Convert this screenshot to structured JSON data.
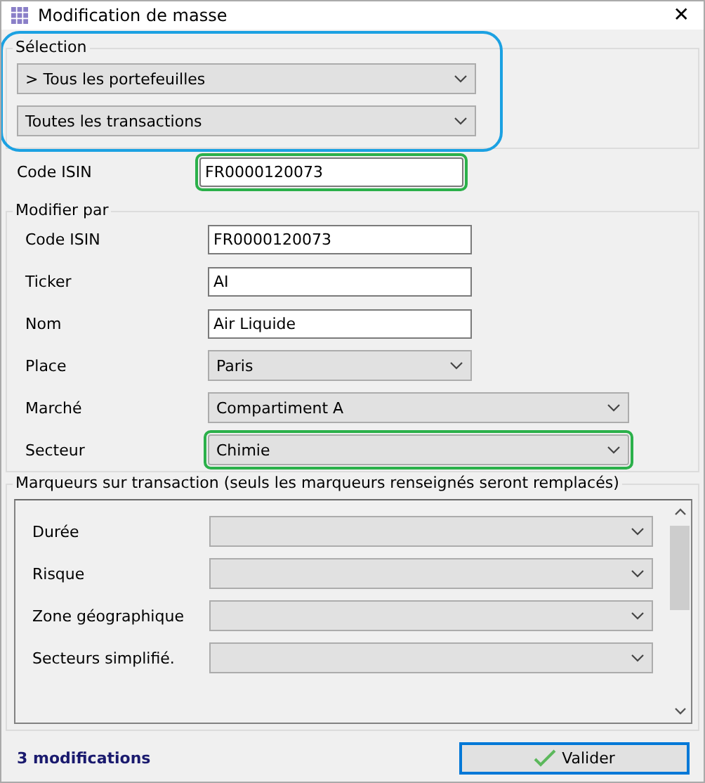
{
  "window": {
    "title": "Modification de masse",
    "close": "✕"
  },
  "selection": {
    "legend": "Sélection",
    "highlight": true,
    "dropdowns": [
      {
        "value": "> Tous les portefeuilles"
      },
      {
        "value": "Toutes les transactions"
      }
    ]
  },
  "filter": {
    "label": "Code ISIN",
    "value": "FR0000120073",
    "highlight": true
  },
  "modifier": {
    "legend": "Modifier par",
    "fields": [
      {
        "label": "Code ISIN",
        "kind": "text",
        "value": "FR0000120073",
        "highlight": false,
        "wide": false
      },
      {
        "label": "Ticker",
        "kind": "text",
        "value": "AI",
        "highlight": false,
        "wide": false
      },
      {
        "label": "Nom",
        "kind": "text",
        "value": "Air Liquide",
        "highlight": false,
        "wide": false
      },
      {
        "label": "Place",
        "kind": "select",
        "value": "Paris",
        "highlight": false,
        "wide": false
      },
      {
        "label": "Marché",
        "kind": "select",
        "value": "Compartiment A",
        "highlight": false,
        "wide": true
      },
      {
        "label": "Secteur",
        "kind": "select",
        "value": "Chimie",
        "highlight": true,
        "wide": true
      }
    ]
  },
  "markers": {
    "legend": "Marqueurs sur transaction (seuls les marqueurs renseignés seront remplacés)",
    "fields": [
      {
        "label": "Durée"
      },
      {
        "label": "Risque"
      },
      {
        "label": "Zone géographique"
      },
      {
        "label": "Secteurs simplifié."
      }
    ]
  },
  "footer": {
    "status": "3 modifications",
    "button": "Valider"
  }
}
